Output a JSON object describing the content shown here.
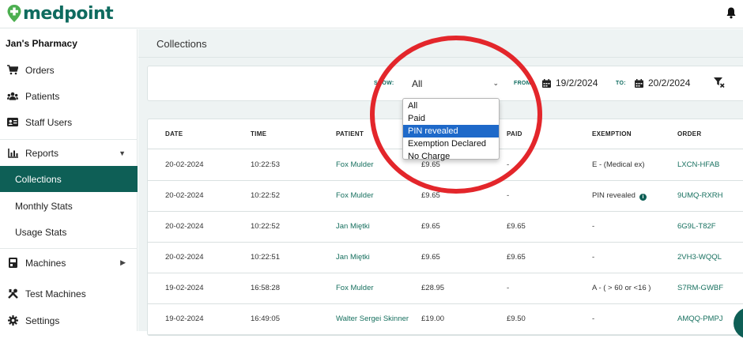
{
  "brand": {
    "name": "medpoint",
    "primary_color": "#0e5f56",
    "accent_color": "#4caf50"
  },
  "sidebar": {
    "pharmacy_name": "Jan's Pharmacy",
    "items": [
      {
        "label": "Orders",
        "icon": "cart-icon"
      },
      {
        "label": "Patients",
        "icon": "users-icon"
      },
      {
        "label": "Staff Users",
        "icon": "id-card-icon"
      },
      {
        "label": "Reports",
        "icon": "chart-icon",
        "expanded": true
      },
      {
        "label": "Collections",
        "active": true
      },
      {
        "label": "Monthly Stats"
      },
      {
        "label": "Usage Stats"
      },
      {
        "label": "Machines",
        "icon": "machine-icon"
      },
      {
        "label": "Test Machines",
        "icon": "tools-icon"
      },
      {
        "label": "Settings",
        "icon": "gear-icon"
      }
    ]
  },
  "page": {
    "title": "Collections"
  },
  "filters": {
    "show_label": "SHOW:",
    "show_value": "All",
    "from_label": "FROM:",
    "from_value": "19/2/2024",
    "to_label": "TO:",
    "to_value": "20/2/2024"
  },
  "dropdown": {
    "options": [
      "All",
      "Paid",
      "PIN revealed",
      "Exemption Declared",
      "No Charge"
    ],
    "highlighted": "PIN revealed"
  },
  "table": {
    "columns": [
      "DATE",
      "TIME",
      "PATIENT",
      "",
      "PAID",
      "EXEMPTION",
      "ORDER"
    ],
    "rows": [
      {
        "date": "20-02-2024",
        "time": "10:22:53",
        "patient": "Fox Mulder",
        "charge": "£9.65",
        "paid": "-",
        "exemption": "E - (Medical ex)",
        "order": "LXCN-HFAB",
        "info": false
      },
      {
        "date": "20-02-2024",
        "time": "10:22:52",
        "patient": "Fox Mulder",
        "charge": "£9.65",
        "paid": "-",
        "exemption": "PIN revealed",
        "order": "9UMQ-RXRH",
        "info": true
      },
      {
        "date": "20-02-2024",
        "time": "10:22:52",
        "patient": "Jan Miętki",
        "charge": "£9.65",
        "paid": "£9.65",
        "exemption": "-",
        "order": "6G9L-T82F",
        "info": false
      },
      {
        "date": "20-02-2024",
        "time": "10:22:51",
        "patient": "Jan Miętki",
        "charge": "£9.65",
        "paid": "£9.65",
        "exemption": "-",
        "order": "2VH3-WQQL",
        "info": false
      },
      {
        "date": "19-02-2024",
        "time": "16:58:28",
        "patient": "Fox Mulder",
        "charge": "£28.95",
        "paid": "-",
        "exemption": "A - ( > 60 or <16 )",
        "order": "S7RM-GWBF",
        "info": false
      },
      {
        "date": "19-02-2024",
        "time": "16:49:05",
        "patient": "Walter Sergei Skinner",
        "charge": "£19.00",
        "paid": "£9.50",
        "exemption": "-",
        "order": "AMQQ-PMPJ",
        "info": false
      }
    ]
  },
  "annotation": {
    "color": "#e3262b"
  }
}
